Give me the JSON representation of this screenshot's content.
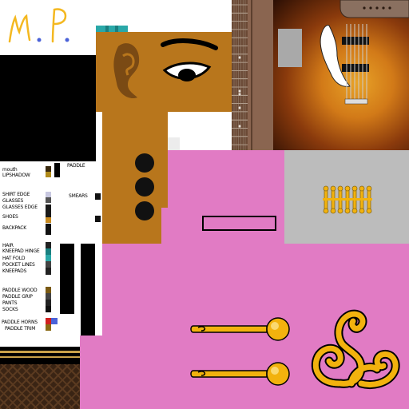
{
  "signature": "M.P.",
  "labels": {
    "mouth": "mouth",
    "lipshadow": "LIPSHADOW",
    "paddle": "PADDLE",
    "shirt_edge": "SHIRT EDGE",
    "glasses": "GLASSES",
    "glasses_edge": "GLASSES EDGE",
    "smears": "SMEARS",
    "shoes": "SHOES",
    "backpack": "BACKPACK",
    "hair": "HAIR",
    "kneepad_hinge": "KNEEPAD HINGE",
    "hat_fold": "HAT FOLD",
    "pocket_lines": "POCKET LINES",
    "kneepads": "KNEEPADS",
    "paddle_wood": "PADDLE WOOD",
    "paddle_grip": "PADDLE GRIP",
    "pants": "PANTS",
    "socks": "SOCKS",
    "paddle_horns": "PADDLE HORNS",
    "paddle_trim": "PADDLE TRIM"
  },
  "colors": {
    "skin": "#b8761c",
    "pink": "#e17bc4",
    "gray_panel": "#bcbcbc",
    "gold": "#f2b20e",
    "teal": "#2aa8a8",
    "black": "#000000",
    "fretboard": "#6b4a36",
    "sunburst_center": "#e8a328",
    "sunburst_edge": "#2a0e04",
    "signature": "#f4b820",
    "signature_dot": "#4a62d8"
  },
  "icons": {
    "guitar": "electric-guitar-icon",
    "face": "cartoon-face-icon",
    "buttons": "round-button-icon",
    "hinges": "gold-hinge-icon",
    "curl": "ornament-curl-icon"
  }
}
